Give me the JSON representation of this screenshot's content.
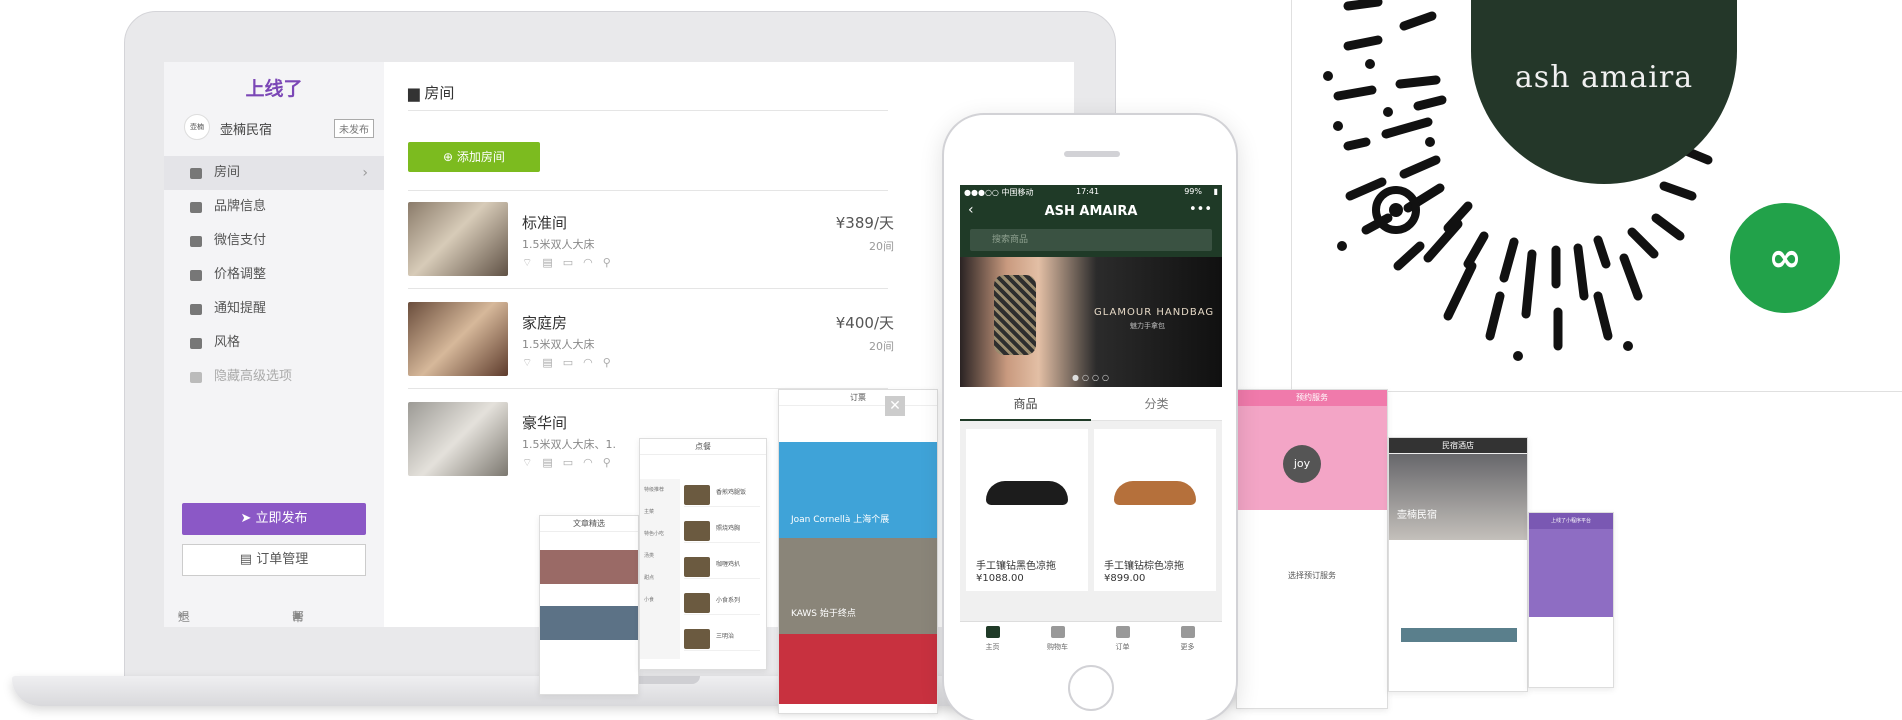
{
  "laptop": {
    "logo": "上线了",
    "account_name": "壶楠民宿",
    "account_status": "未发布",
    "avatar_text": "壶楠",
    "menu": [
      {
        "label": "房间",
        "icon": "building-icon"
      },
      {
        "label": "品牌信息",
        "icon": "info-icon"
      },
      {
        "label": "微信支付",
        "icon": "wechat-pay-icon"
      },
      {
        "label": "价格调整",
        "icon": "chart-icon"
      },
      {
        "label": "通知提醒",
        "icon": "bell-icon"
      },
      {
        "label": "风格",
        "icon": "palette-icon"
      },
      {
        "label": "隐藏高级选项",
        "icon": "caret-up-icon"
      }
    ],
    "publish_label": "立即发布",
    "orders_label": "订单管理",
    "exit_label": "退出编辑器",
    "help_label": "帮助文档",
    "main_title": "房间",
    "add_room_label": "添加房间",
    "rooms": [
      {
        "name": "标准间",
        "desc": "1.5米双人大床",
        "price": "¥389/天",
        "count": "20间"
      },
      {
        "name": "家庭房",
        "desc": "1.5米双人大床",
        "price": "¥400/天",
        "count": "20间"
      },
      {
        "name": "豪华间",
        "desc": "1.5米双人大床、1.",
        "price": "",
        "count": ""
      }
    ],
    "amenities": "⌔▤▭◠⚲"
  },
  "phone": {
    "carrier": "●●●○○ 中国移动",
    "time": "17:41",
    "battery": "99%",
    "title": "ASH AMAIRA",
    "search_placeholder": "搜索商品",
    "banner_title": "GLAMOUR HANDBAG",
    "banner_sub": "魅力手拿包",
    "tab_goods": "商品",
    "tab_category": "分类",
    "products": [
      {
        "name": "手工镶钻黑色凉拖",
        "price": "¥1088.00"
      },
      {
        "name": "手工镶钻棕色凉拖",
        "price": "¥899.00"
      }
    ],
    "tabbar": [
      "主页",
      "购物车",
      "订单",
      "更多"
    ]
  },
  "qr": {
    "brand": "ash amaira"
  },
  "cards": {
    "order_title": "订票",
    "order_caption1": "Joan Cornellà 上海个展",
    "order_caption2": "KAWS 始于终点",
    "menu_title": "点餐",
    "menu_side": [
      "特级推荐",
      "主菜",
      "特色小吃",
      "汤类",
      "甜点",
      "小食"
    ],
    "menu_dishes": [
      "香煎鸡腿饭",
      "照烧鸡胸",
      "咖喱鸡扒",
      "小食系列",
      "三明治"
    ],
    "culture_title": "文章精选",
    "pink_title": "预约服务",
    "pink_joy": "joy",
    "pink_label": "选择预订服务",
    "hotel_title": "民宿酒店",
    "hotel_name": "壶楠民宿",
    "purple_title": "上线了小程序平台"
  }
}
